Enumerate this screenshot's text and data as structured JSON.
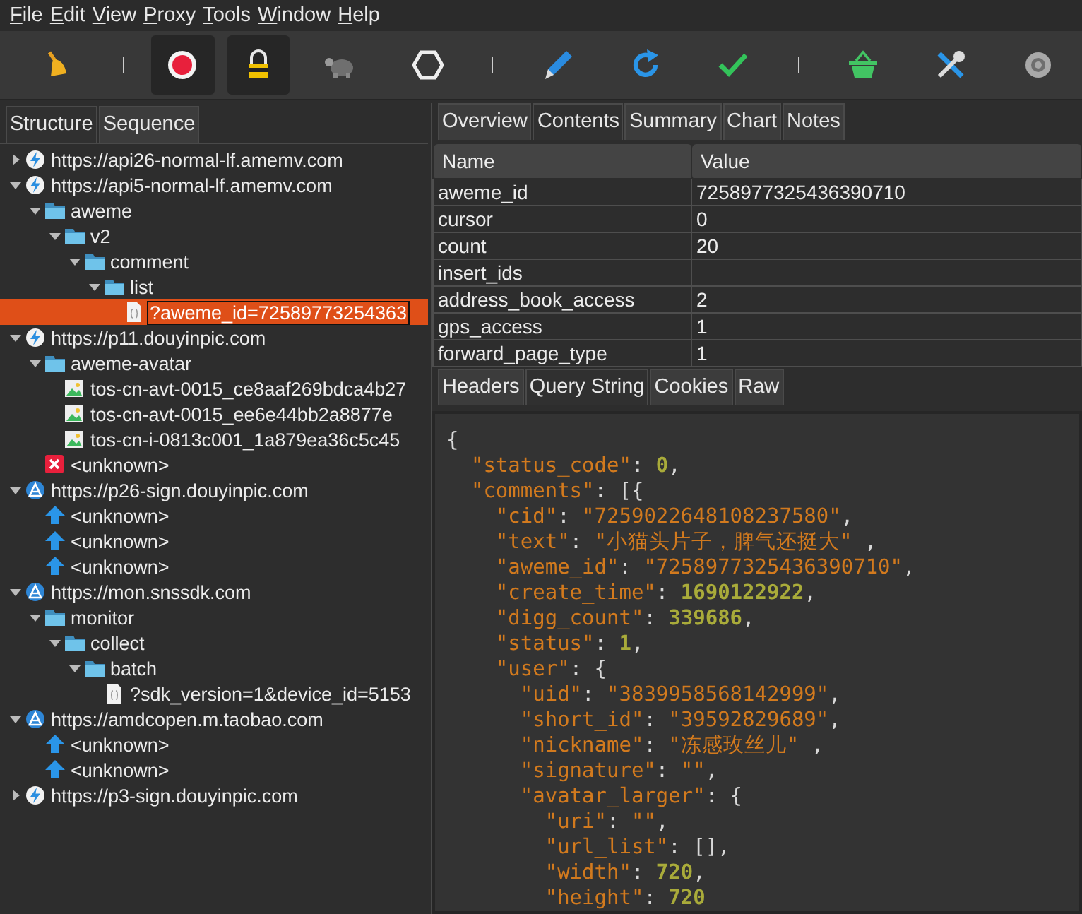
{
  "menu": [
    {
      "label": "File"
    },
    {
      "label": "Edit"
    },
    {
      "label": "View"
    },
    {
      "label": "Proxy"
    },
    {
      "label": "Tools"
    },
    {
      "label": "Window"
    },
    {
      "label": "Help"
    }
  ],
  "toolbar": [
    {
      "kind": "button",
      "pressed": false
    },
    {
      "kind": "separator"
    },
    {
      "kind": "button",
      "pressed": true
    },
    {
      "kind": "button",
      "pressed": true
    },
    {
      "kind": "button",
      "pressed": false
    },
    {
      "kind": "button",
      "pressed": false
    },
    {
      "kind": "separator"
    },
    {
      "kind": "button",
      "pressed": false
    },
    {
      "kind": "button",
      "pressed": false
    },
    {
      "kind": "button",
      "pressed": false
    },
    {
      "kind": "separator"
    },
    {
      "kind": "button",
      "pressed": false
    },
    {
      "kind": "button",
      "pressed": false
    },
    {
      "kind": "button",
      "pressed": false
    }
  ],
  "left_tabs": [
    {
      "label": "Structure",
      "selected": true
    },
    {
      "label": "Sequence",
      "selected": false
    }
  ],
  "tree": [
    {
      "kind": "host",
      "label": "https://api26-normal-lf.amemv.com",
      "expanded": false,
      "selected": false
    },
    {
      "kind": "host",
      "label": "https://api5-normal-lf.amemv.com",
      "expanded": true,
      "selected": false,
      "children": [
        {
          "kind": "folder",
          "label": "aweme",
          "expanded": true,
          "selected": false,
          "children": [
            {
              "kind": "folder",
              "label": "v2",
              "expanded": true,
              "selected": false,
              "children": [
                {
                  "kind": "folder",
                  "label": "comment",
                  "expanded": true,
                  "selected": false,
                  "children": [
                    {
                      "kind": "folder",
                      "label": "list",
                      "expanded": true,
                      "selected": false,
                      "children": [
                        {
                          "kind": "file",
                          "label": "?aweme_id=72589773254363",
                          "selected": true
                        }
                      ]
                    }
                  ]
                }
              ]
            }
          ]
        }
      ]
    },
    {
      "kind": "host",
      "label": "https://p11.douyinpic.com",
      "expanded": true,
      "selected": false,
      "children": [
        {
          "kind": "folder",
          "label": "aweme-avatar",
          "expanded": true,
          "selected": false,
          "children": [
            {
              "kind": "image",
              "label": "tos-cn-avt-0015_ce8aaf269bdca4b27",
              "selected": false
            },
            {
              "kind": "image",
              "label": "tos-cn-avt-0015_ee6e44bb2a8877e",
              "selected": false
            },
            {
              "kind": "image",
              "label": "tos-cn-i-0813c001_1a879ea36c5c45",
              "selected": false
            }
          ]
        },
        {
          "kind": "error",
          "label": "<unknown>",
          "selected": false
        }
      ]
    },
    {
      "kind": "relay",
      "label": "https://p26-sign.douyinpic.com",
      "expanded": true,
      "selected": false,
      "children": [
        {
          "kind": "upload",
          "label": "<unknown>",
          "selected": false
        },
        {
          "kind": "upload",
          "label": "<unknown>",
          "selected": false
        },
        {
          "kind": "upload",
          "label": "<unknown>",
          "selected": false
        }
      ]
    },
    {
      "kind": "relay",
      "label": "https://mon.snssdk.com",
      "expanded": true,
      "selected": false,
      "children": [
        {
          "kind": "folder",
          "label": "monitor",
          "expanded": true,
          "selected": false,
          "children": [
            {
              "kind": "folder",
              "label": "collect",
              "expanded": true,
              "selected": false,
              "children": [
                {
                  "kind": "folder",
                  "label": "batch",
                  "expanded": true,
                  "selected": false,
                  "children": [
                    {
                      "kind": "file",
                      "label": "?sdk_version=1&device_id=5153",
                      "selected": false
                    }
                  ]
                }
              ]
            }
          ]
        }
      ]
    },
    {
      "kind": "relay",
      "label": "https://amdcopen.m.taobao.com",
      "expanded": true,
      "selected": false,
      "children": [
        {
          "kind": "upload",
          "label": "<unknown>",
          "selected": false
        },
        {
          "kind": "upload",
          "label": "<unknown>",
          "selected": false
        }
      ]
    },
    {
      "kind": "host",
      "label": "https://p3-sign.douyinpic.com",
      "expanded": false,
      "selected": false
    }
  ],
  "right_tabs": [
    {
      "label": "Overview",
      "selected": false
    },
    {
      "label": "Contents",
      "selected": true
    },
    {
      "label": "Summary",
      "selected": false
    },
    {
      "label": "Chart",
      "selected": false
    },
    {
      "label": "Notes",
      "selected": false
    }
  ],
  "table": {
    "columns": [
      "Name",
      "Value"
    ],
    "rows": [
      [
        "aweme_id",
        "7258977325436390710"
      ],
      [
        "cursor",
        "0"
      ],
      [
        "count",
        "20"
      ],
      [
        "insert_ids",
        ""
      ],
      [
        "address_book_access",
        "2"
      ],
      [
        "gps_access",
        "1"
      ],
      [
        "forward_page_type",
        "1"
      ]
    ]
  },
  "sub_tabs": [
    {
      "label": "Headers",
      "selected": false
    },
    {
      "label": "Query String",
      "selected": true
    },
    {
      "label": "Cookies",
      "selected": false
    },
    {
      "label": "Raw",
      "selected": false
    }
  ],
  "code_lines": [
    [
      {
        "kind": "punct",
        "text": "{"
      }
    ],
    [
      {
        "kind": "key",
        "text": "  \"status_code\""
      },
      {
        "kind": "punct",
        "text": ": "
      },
      {
        "kind": "number",
        "text": "0"
      },
      {
        "kind": "punct",
        "text": ","
      }
    ],
    [
      {
        "kind": "key",
        "text": "  \"comments\""
      },
      {
        "kind": "punct",
        "text": ": [{"
      }
    ],
    [
      {
        "kind": "key",
        "text": "    \"cid\""
      },
      {
        "kind": "punct",
        "text": ": "
      },
      {
        "kind": "string",
        "text": "\"7259022648108237580\""
      },
      {
        "kind": "punct",
        "text": ","
      }
    ],
    [
      {
        "kind": "key",
        "text": "    \"text\""
      },
      {
        "kind": "punct",
        "text": ": "
      },
      {
        "kind": "string",
        "text": "\"小猫头片子，脾气还挺大\""
      },
      {
        "kind": "punct",
        "text": " ,"
      }
    ],
    [
      {
        "kind": "key",
        "text": "    \"aweme_id\""
      },
      {
        "kind": "punct",
        "text": ": "
      },
      {
        "kind": "string",
        "text": "\"7258977325436390710\""
      },
      {
        "kind": "punct",
        "text": ","
      }
    ],
    [
      {
        "kind": "key",
        "text": "    \"create_time\""
      },
      {
        "kind": "punct",
        "text": ": "
      },
      {
        "kind": "number",
        "text": "1690122922"
      },
      {
        "kind": "punct",
        "text": ","
      }
    ],
    [
      {
        "kind": "key",
        "text": "    \"digg_count\""
      },
      {
        "kind": "punct",
        "text": ": "
      },
      {
        "kind": "number",
        "text": "339686"
      },
      {
        "kind": "punct",
        "text": ","
      }
    ],
    [
      {
        "kind": "key",
        "text": "    \"status\""
      },
      {
        "kind": "punct",
        "text": ": "
      },
      {
        "kind": "number",
        "text": "1"
      },
      {
        "kind": "punct",
        "text": ","
      }
    ],
    [
      {
        "kind": "key",
        "text": "    \"user\""
      },
      {
        "kind": "punct",
        "text": ": {"
      }
    ],
    [
      {
        "kind": "key",
        "text": "      \"uid\""
      },
      {
        "kind": "punct",
        "text": ": "
      },
      {
        "kind": "string",
        "text": "\"3839958568142999\""
      },
      {
        "kind": "punct",
        "text": ","
      }
    ],
    [
      {
        "kind": "key",
        "text": "      \"short_id\""
      },
      {
        "kind": "punct",
        "text": ": "
      },
      {
        "kind": "string",
        "text": "\"39592829689\""
      },
      {
        "kind": "punct",
        "text": ","
      }
    ],
    [
      {
        "kind": "key",
        "text": "      \"nickname\""
      },
      {
        "kind": "punct",
        "text": ": "
      },
      {
        "kind": "string",
        "text": "\"冻感玫丝儿\""
      },
      {
        "kind": "punct",
        "text": " ,"
      }
    ],
    [
      {
        "kind": "key",
        "text": "      \"signature\""
      },
      {
        "kind": "punct",
        "text": ": "
      },
      {
        "kind": "string",
        "text": "\"\""
      },
      {
        "kind": "punct",
        "text": ","
      }
    ],
    [
      {
        "kind": "key",
        "text": "      \"avatar_larger\""
      },
      {
        "kind": "punct",
        "text": ": {"
      }
    ],
    [
      {
        "kind": "key",
        "text": "        \"uri\""
      },
      {
        "kind": "punct",
        "text": ": "
      },
      {
        "kind": "string",
        "text": "\"\""
      },
      {
        "kind": "punct",
        "text": ","
      }
    ],
    [
      {
        "kind": "key",
        "text": "        \"url_list\""
      },
      {
        "kind": "punct",
        "text": ": [],"
      }
    ],
    [
      {
        "kind": "key",
        "text": "        \"width\""
      },
      {
        "kind": "punct",
        "text": ": "
      },
      {
        "kind": "number",
        "text": "720"
      },
      {
        "kind": "punct",
        "text": ","
      }
    ],
    [
      {
        "kind": "key",
        "text": "        \"height\""
      },
      {
        "kind": "punct",
        "text": ": "
      },
      {
        "kind": "number",
        "text": "720"
      }
    ]
  ]
}
